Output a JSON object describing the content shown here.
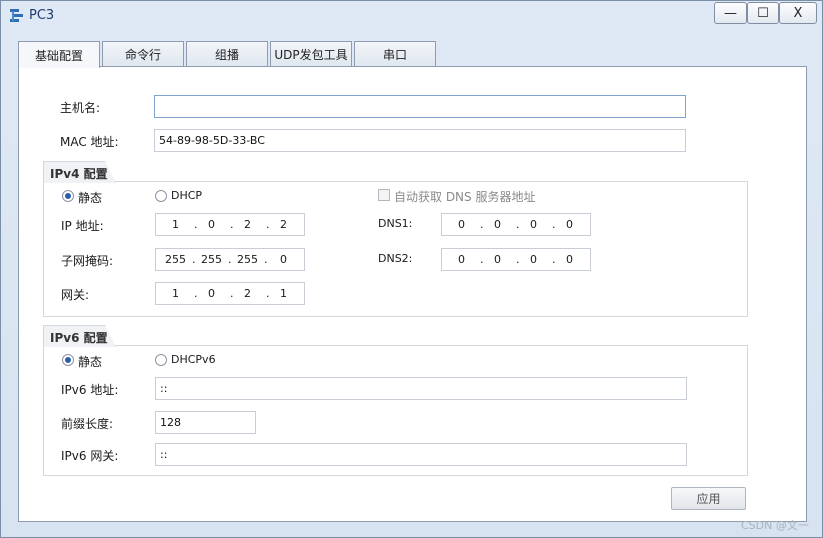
{
  "window": {
    "title": "PC3",
    "min": "—",
    "max": "☐",
    "close": "X"
  },
  "tabs": [
    {
      "label": "基础配置"
    },
    {
      "label": "命令行"
    },
    {
      "label": "组播"
    },
    {
      "label": "UDP发包工具"
    },
    {
      "label": "串口"
    }
  ],
  "basic": {
    "hostname_label": "主机名:",
    "hostname_value": "",
    "mac_label": "MAC 地址:",
    "mac_value": "54-89-98-5D-33-BC"
  },
  "ipv4": {
    "title": "IPv4 配置",
    "static_label": "静态",
    "dhcp_label": "DHCP",
    "auto_dns_label": "自动获取 DNS 服务器地址",
    "ip_label": "IP 地址:",
    "ip": [
      "1",
      "0",
      "2",
      "2"
    ],
    "mask_label": "子网掩码:",
    "mask": [
      "255",
      "255",
      "255",
      "0"
    ],
    "gateway_label": "网关:",
    "gateway": [
      "1",
      "0",
      "2",
      "1"
    ],
    "dns1_label": "DNS1:",
    "dns1": [
      "0",
      "0",
      "0",
      "0"
    ],
    "dns2_label": "DNS2:",
    "dns2": [
      "0",
      "0",
      "0",
      "0"
    ]
  },
  "ipv6": {
    "title": "IPv6 配置",
    "static_label": "静态",
    "dhcpv6_label": "DHCPv6",
    "ip_label": "IPv6 地址:",
    "ip_value": "::",
    "prefix_label": "前缀长度:",
    "prefix_value": "128",
    "gateway_label": "IPv6 网关:",
    "gateway_value": "::"
  },
  "apply_label": "应用",
  "watermark": "CSDN @文一"
}
